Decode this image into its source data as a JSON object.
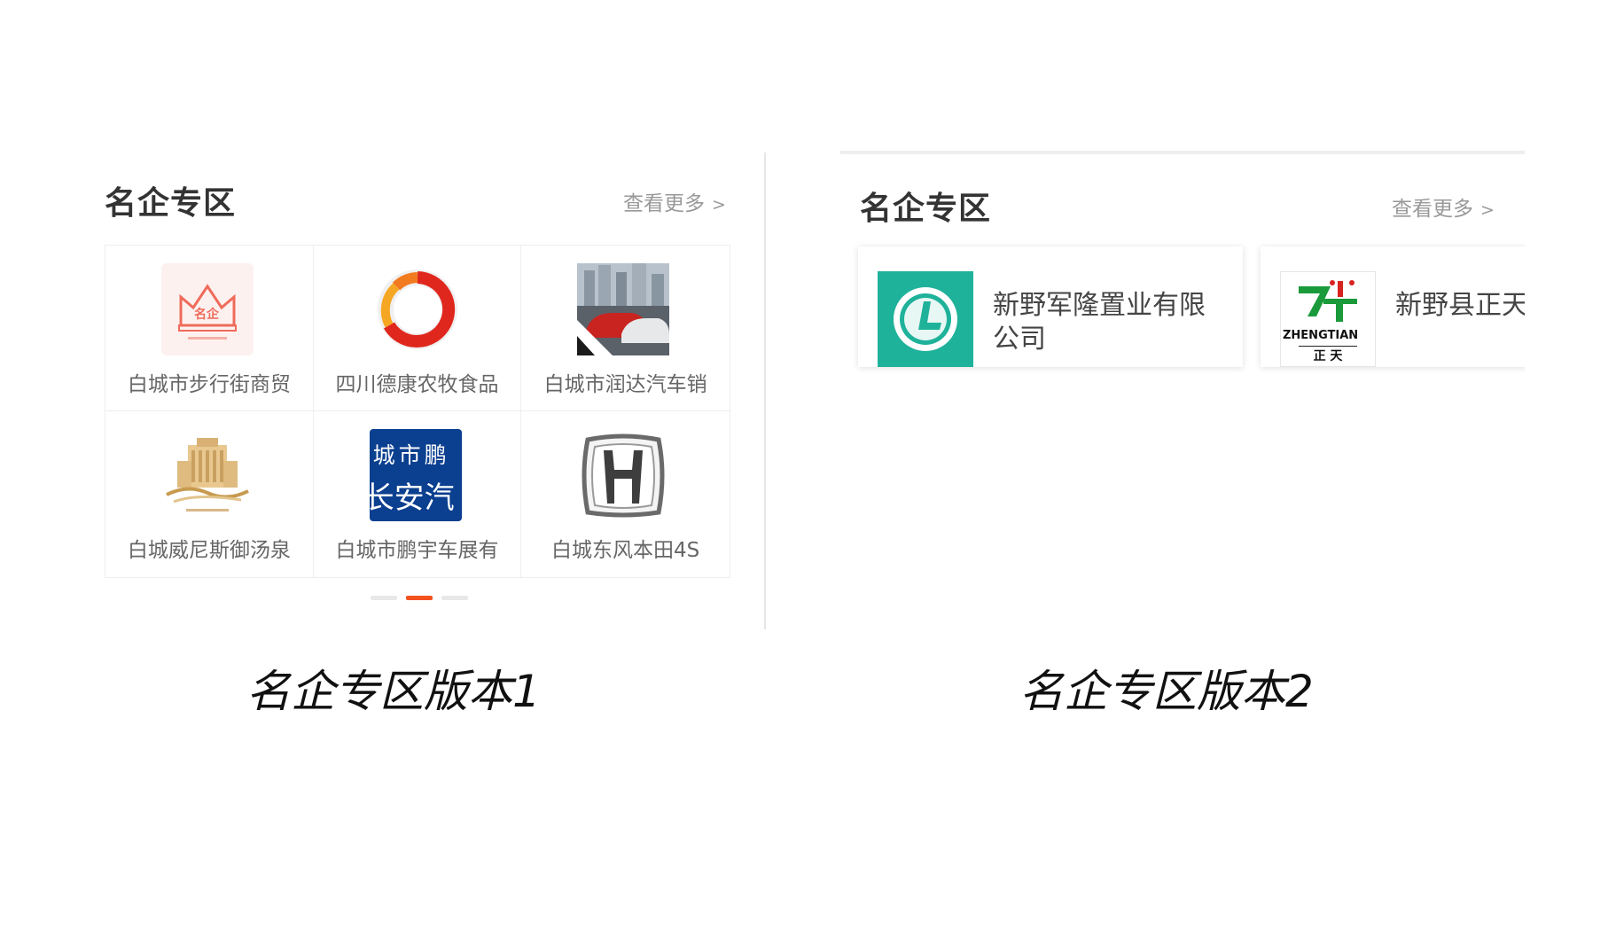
{
  "version1": {
    "title": "名企专区",
    "more": "查看更多",
    "more_chevron": ">",
    "companies": [
      {
        "name": "白城市步行街商贸",
        "logo_icon": "crown-mingqi-logo",
        "logo_text": "名企"
      },
      {
        "name": "四川德康农牧食品",
        "logo_icon": "red-ring-logo"
      },
      {
        "name": "白城市润达汽车销",
        "logo_icon": "car-showroom-photo"
      },
      {
        "name": "白城威尼斯御汤泉",
        "logo_icon": "hotel-building-logo"
      },
      {
        "name": "白城市鹏宇车展有",
        "logo_icon": "changan-blue-sign-logo",
        "logo_line1": "城市鹏",
        "logo_line2": "长安汽"
      },
      {
        "name": "白城东风本田4S",
        "logo_icon": "honda-h-logo"
      }
    ],
    "pagination": {
      "count": 3,
      "active_index": 1
    }
  },
  "version2": {
    "title": "名企专区",
    "more": "查看更多",
    "more_chevron": ">",
    "companies": [
      {
        "name": "新野军隆置业有限公司",
        "logo_icon": "teal-l-circle-logo"
      },
      {
        "name": "新野县正天科技有限公",
        "logo_icon": "zhengtian-logo",
        "logo_text_en": "ZHENGTIAN",
        "logo_text_cn": "正 天"
      }
    ]
  },
  "captions": {
    "v1": "名企专区版本1",
    "v2": "名企专区版本2"
  },
  "colors": {
    "accent": "#f4511e",
    "teal": "#1fb29a",
    "changan_blue": "#0b3f8f",
    "zhengtian_green": "#1a9a3a",
    "zhengtian_red": "#d8221f"
  }
}
